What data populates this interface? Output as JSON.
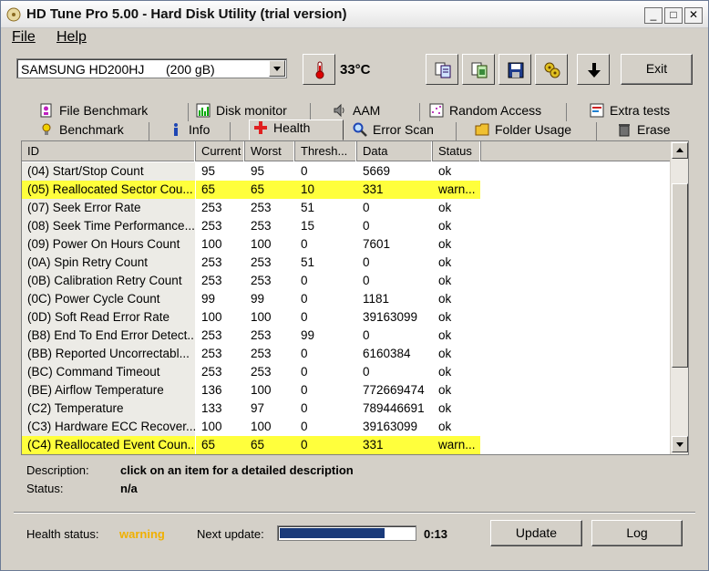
{
  "window": {
    "title": "HD Tune Pro 5.00 - Hard Disk Utility (trial version)",
    "buttons": {
      "minimize": "_",
      "maximize": "□",
      "close": "✕"
    }
  },
  "menu": [
    {
      "label": "File"
    },
    {
      "label": "Help"
    }
  ],
  "toolbar": {
    "drive_name": "SAMSUNG HD200HJ",
    "drive_size": "(200 gB)",
    "temperature": "33°C",
    "temperature_value": "33",
    "exit_label": "Exit",
    "icons": [
      "thermometer-icon",
      "copy-text-icon",
      "copy-screenshot-icon",
      "save-icon",
      "options-icon",
      "download-icon"
    ]
  },
  "tabs": {
    "row1": [
      {
        "label": "File Benchmark",
        "icon": "file-benchmark-icon"
      },
      {
        "label": "Disk monitor",
        "icon": "disk-monitor-icon"
      },
      {
        "label": "AAM",
        "icon": "speaker-icon"
      },
      {
        "label": "Random Access",
        "icon": "random-access-icon"
      },
      {
        "label": "Extra tests",
        "icon": "extra-tests-icon"
      }
    ],
    "row2": [
      {
        "label": "Benchmark",
        "icon": "benchmark-icon"
      },
      {
        "label": "Info",
        "icon": "info-icon"
      },
      {
        "label": "Health",
        "icon": "health-cross-icon",
        "active": true
      },
      {
        "label": "Error Scan",
        "icon": "magnifier-icon"
      },
      {
        "label": "Folder Usage",
        "icon": "folder-icon"
      },
      {
        "label": "Erase",
        "icon": "trash-icon"
      }
    ]
  },
  "table": {
    "columns": [
      "ID",
      "Current",
      "Worst",
      "Thresh...",
      "Data",
      "Status"
    ],
    "rows": [
      {
        "id": "(04) Start/Stop Count",
        "current": "95",
        "worst": "95",
        "thresh": "0",
        "data": "5669",
        "status": "ok",
        "warn": false
      },
      {
        "id": "(05) Reallocated Sector Cou...",
        "current": "65",
        "worst": "65",
        "thresh": "10",
        "data": "331",
        "status": "warn...",
        "warn": true
      },
      {
        "id": "(07) Seek Error Rate",
        "current": "253",
        "worst": "253",
        "thresh": "51",
        "data": "0",
        "status": "ok",
        "warn": false
      },
      {
        "id": "(08) Seek Time Performance...",
        "current": "253",
        "worst": "253",
        "thresh": "15",
        "data": "0",
        "status": "ok",
        "warn": false
      },
      {
        "id": "(09) Power On Hours Count",
        "current": "100",
        "worst": "100",
        "thresh": "0",
        "data": "7601",
        "status": "ok",
        "warn": false
      },
      {
        "id": "(0A) Spin Retry Count",
        "current": "253",
        "worst": "253",
        "thresh": "51",
        "data": "0",
        "status": "ok",
        "warn": false
      },
      {
        "id": "(0B) Calibration Retry Count",
        "current": "253",
        "worst": "253",
        "thresh": "0",
        "data": "0",
        "status": "ok",
        "warn": false
      },
      {
        "id": "(0C) Power Cycle Count",
        "current": "99",
        "worst": "99",
        "thresh": "0",
        "data": "1181",
        "status": "ok",
        "warn": false
      },
      {
        "id": "(0D) Soft Read Error Rate",
        "current": "100",
        "worst": "100",
        "thresh": "0",
        "data": "39163099",
        "status": "ok",
        "warn": false
      },
      {
        "id": "(B8) End To End Error Detect...",
        "current": "253",
        "worst": "253",
        "thresh": "99",
        "data": "0",
        "status": "ok",
        "warn": false
      },
      {
        "id": "(BB) Reported Uncorrectabl...",
        "current": "253",
        "worst": "253",
        "thresh": "0",
        "data": "6160384",
        "status": "ok",
        "warn": false
      },
      {
        "id": "(BC) Command Timeout",
        "current": "253",
        "worst": "253",
        "thresh": "0",
        "data": "0",
        "status": "ok",
        "warn": false
      },
      {
        "id": "(BE) Airflow Temperature",
        "current": "136",
        "worst": "100",
        "thresh": "0",
        "data": "772669474",
        "status": "ok",
        "warn": false
      },
      {
        "id": "(C2) Temperature",
        "current": "133",
        "worst": "97",
        "thresh": "0",
        "data": "789446691",
        "status": "ok",
        "warn": false
      },
      {
        "id": "(C3) Hardware ECC Recover...",
        "current": "100",
        "worst": "100",
        "thresh": "0",
        "data": "39163099",
        "status": "ok",
        "warn": false
      },
      {
        "id": "(C4) Reallocated Event Coun...",
        "current": "65",
        "worst": "65",
        "thresh": "0",
        "data": "331",
        "status": "warn...",
        "warn": true
      }
    ]
  },
  "details": {
    "description_label": "Description:",
    "description_value": "click on an item for a detailed description",
    "status_label": "Status:",
    "status_value": "n/a"
  },
  "footer": {
    "health_label": "Health status:",
    "health_value": "warning",
    "next_update_label": "Next update:",
    "next_update_time": "0:13",
    "progress_fraction": 0.77,
    "update_button": "Update",
    "log_button": "Log"
  },
  "colors": {
    "warning_highlight": "#ffff3c",
    "warning_text": "#f0b000",
    "progress_fill": "#1a3a7a",
    "window_face": "#d4d0c8"
  }
}
